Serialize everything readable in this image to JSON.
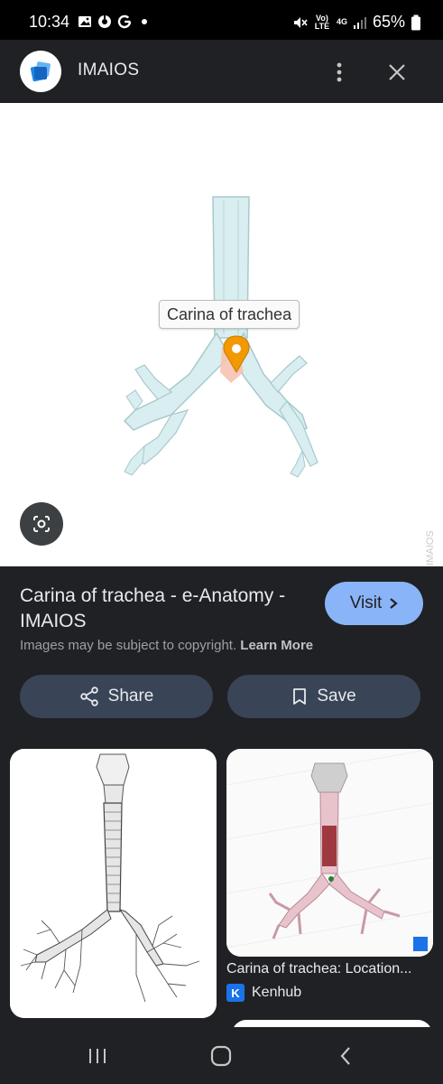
{
  "status_bar": {
    "time": "10:34",
    "volte": "Vo) LTE",
    "network": "4G",
    "battery": "65%"
  },
  "header": {
    "site_name": "IMAIOS",
    "icons": [
      "imaios-logo-icon",
      "more-vert-icon",
      "close-icon"
    ]
  },
  "image": {
    "label": "Carina of trachea",
    "watermark": "© IMAIOS",
    "lens_icon": "google-lens-icon"
  },
  "result": {
    "title": "Carina of trachea - e-Anatomy - IMAIOS",
    "visit_label": "Visit",
    "copyright_text": "Images may be subject to copyright.",
    "learn_more": "Learn More",
    "share_label": "Share",
    "save_label": "Save"
  },
  "related": [
    {
      "title": "",
      "source": ""
    },
    {
      "title": "Carina of trachea: Location...",
      "source": "Kenhub",
      "badge": "K"
    }
  ],
  "nav": {
    "icons": [
      "recent-apps-icon",
      "home-icon",
      "back-icon"
    ]
  },
  "colors": {
    "accent": "#8ab4f8",
    "panel": "#202124",
    "button": "#394457",
    "pin": "#f29900"
  }
}
